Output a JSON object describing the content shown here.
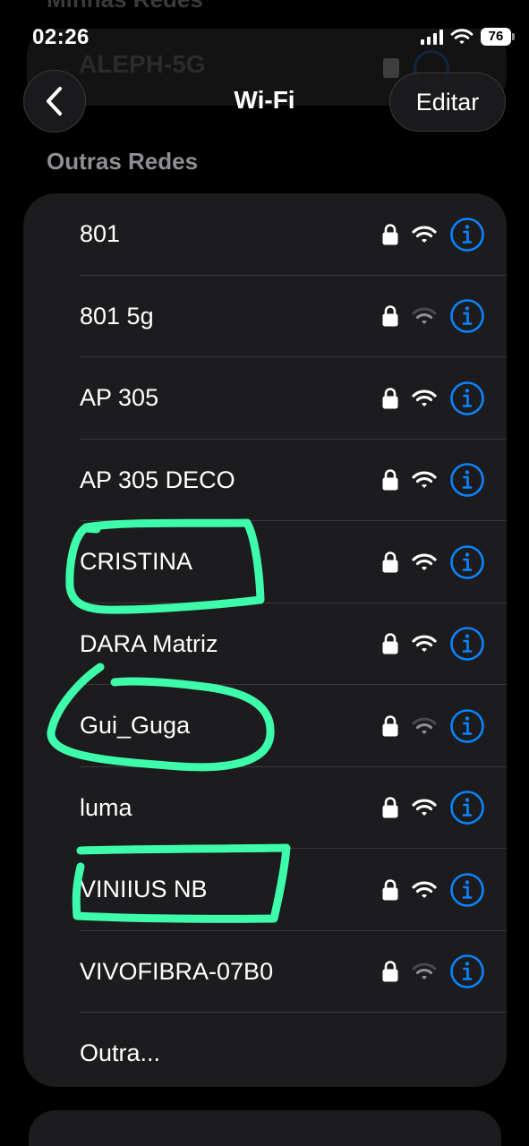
{
  "status_bar": {
    "time": "02:26",
    "battery": "76"
  },
  "previous_section": {
    "heading": "Minhas Redes",
    "network": "ALEPH-5G"
  },
  "nav": {
    "title": "Wi-Fi",
    "edit_label": "Editar"
  },
  "section_heading": "Outras Redes",
  "networks": [
    {
      "name": "801",
      "locked": true,
      "signal": "full"
    },
    {
      "name": "801 5g",
      "locked": true,
      "signal": "weak"
    },
    {
      "name": "AP 305",
      "locked": true,
      "signal": "full"
    },
    {
      "name": "AP 305 DECO",
      "locked": true,
      "signal": "full"
    },
    {
      "name": "CRISTINA",
      "locked": true,
      "signal": "full",
      "highlighted": true
    },
    {
      "name": "DARA Matriz",
      "locked": true,
      "signal": "full"
    },
    {
      "name": "Gui_Guga",
      "locked": true,
      "signal": "weak",
      "highlighted": true
    },
    {
      "name": "luma",
      "locked": true,
      "signal": "full"
    },
    {
      "name": "VINIIUS NB",
      "locked": true,
      "signal": "full",
      "highlighted": true
    },
    {
      "name": "VIVOFIBRA-07B0",
      "locked": true,
      "signal": "weak"
    }
  ],
  "other_label": "Outra...",
  "colors": {
    "accent": "#0a84ff",
    "highlight": "#3dfcaa",
    "card": "#1c1c1e"
  },
  "icons": [
    "chevron-left-icon",
    "lock-icon",
    "wifi-icon",
    "info-icon",
    "cellular-signal-icon",
    "battery-icon"
  ]
}
